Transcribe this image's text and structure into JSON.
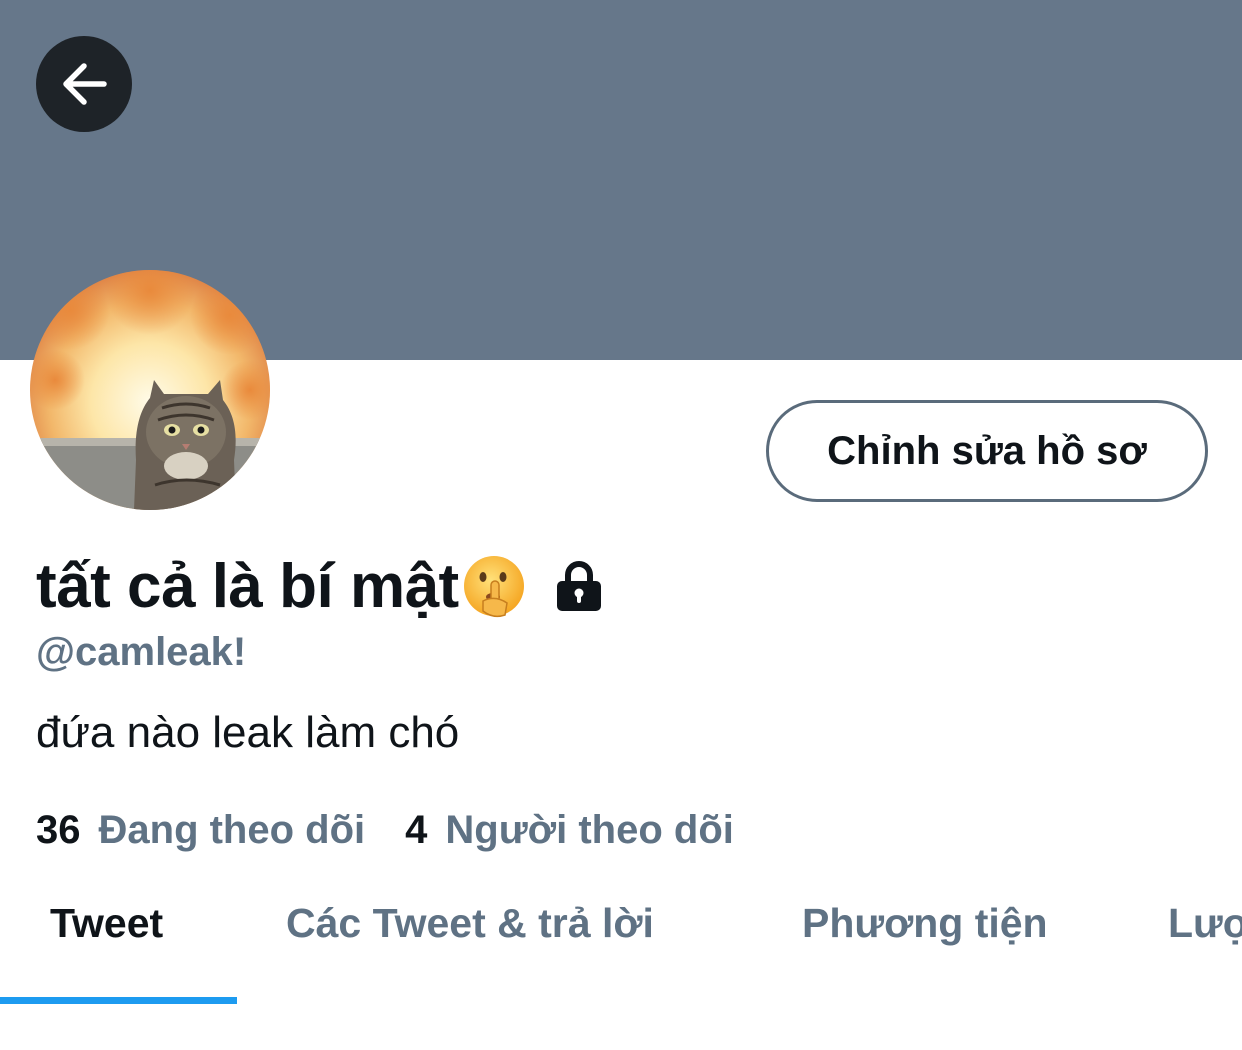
{
  "header": {
    "back_icon": "arrow-left-icon",
    "banner_color": "#66778a"
  },
  "profile": {
    "display_name": "tất cả là bí mật",
    "name_emoji": "shushing-face-emoji",
    "protected_icon": "lock-icon",
    "handle": "@camleak!",
    "bio": "đứa nào leak làm chó",
    "edit_button_label": "Chỉnh sửa hồ sơ"
  },
  "stats": {
    "following_count": "36",
    "following_label": "Đang theo dõi",
    "followers_count": "4",
    "followers_label": "Người theo dõi"
  },
  "tabs": [
    {
      "label": "Tweet",
      "active": true
    },
    {
      "label": "Các Tweet & trả lời",
      "active": false
    },
    {
      "label": "Phương tiện",
      "active": false
    },
    {
      "label": "Lượt thích",
      "active": false
    }
  ],
  "colors": {
    "accent": "#1d9bf0",
    "secondary_text": "#5f7284",
    "primary_text": "#0f1419"
  }
}
